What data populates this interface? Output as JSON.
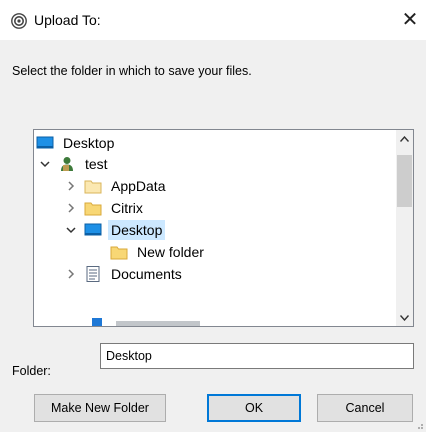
{
  "window": {
    "title": "Upload To:",
    "close_glyph": "✕",
    "app_icon": "upload-app-icon"
  },
  "instruction": "Select the folder in which to save your files.",
  "tree": {
    "items": [
      {
        "label": "Desktop",
        "icon": "desktop-icon",
        "expander": "none",
        "level": 0
      },
      {
        "label": "test",
        "icon": "user-icon",
        "expander": "expanded",
        "level": 0
      },
      {
        "label": "AppData",
        "icon": "folder-icon",
        "expander": "collapsed",
        "level": 1
      },
      {
        "label": "Citrix",
        "icon": "folder-icon",
        "expander": "collapsed",
        "level": 1
      },
      {
        "label": "Desktop",
        "icon": "desktop-icon",
        "expander": "expanded",
        "level": 1,
        "selected": true
      },
      {
        "label": "New folder",
        "icon": "folder-icon",
        "expander": "none",
        "level": 2
      },
      {
        "label": "Documents",
        "icon": "documents-icon",
        "expander": "collapsed",
        "level": 1
      }
    ]
  },
  "folder": {
    "label": "Folder:",
    "value": "Desktop"
  },
  "buttons": {
    "make_new_folder": "Make New Folder",
    "ok": "OK",
    "cancel": "Cancel"
  },
  "colors": {
    "selection": "#cce8ff",
    "primary_border": "#0078d7",
    "folder_yellow": "#f8d775",
    "desktop_blue": "#1e90e6"
  }
}
